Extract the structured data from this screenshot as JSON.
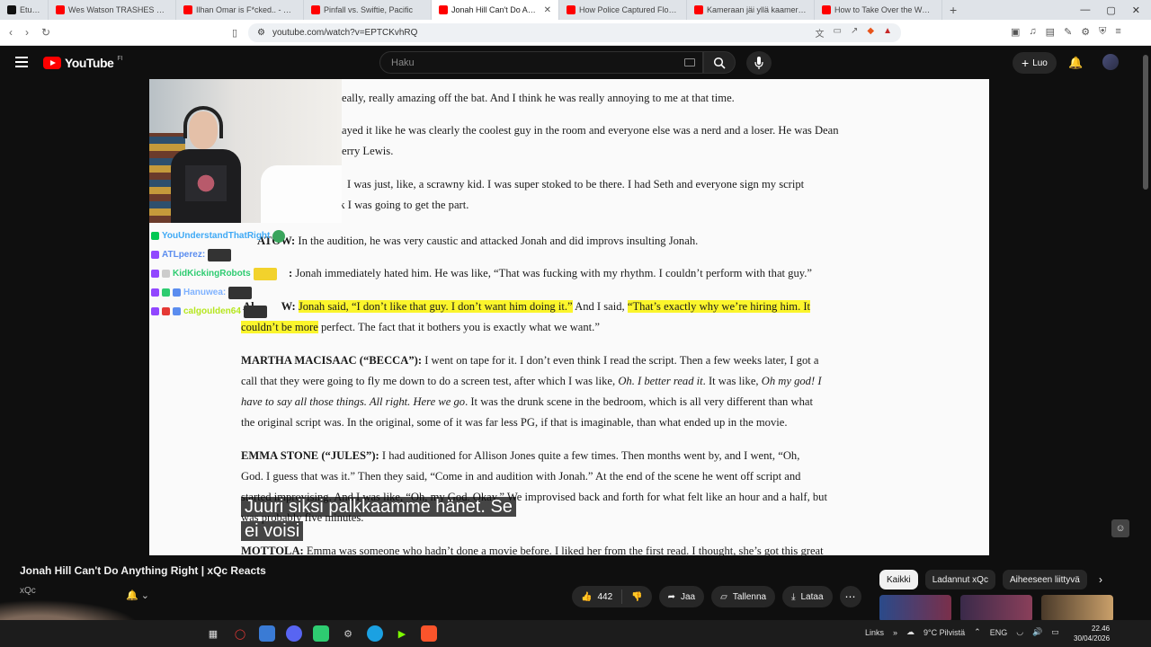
{
  "browser": {
    "tabs": [
      {
        "label": "Etusivu / X",
        "color": "#111111"
      },
      {
        "label": "Wes Watson TRASHES VICTIM",
        "color": "#ff0000"
      },
      {
        "label": "Ilhan Omar is F*cked.. - YouTu",
        "color": "#ff0000"
      },
      {
        "label": "Pinfall vs. Swiftie, Pacific",
        "color": "#ff0000"
      },
      {
        "label": "Jonah Hill Can't Do Anything",
        "color": "#ff0000"
      },
      {
        "label": "How Police Captured Florida's",
        "color": "#ff0000"
      },
      {
        "label": "Kameraan jäi yllä kaamerassa",
        "color": "#ff0000"
      },
      {
        "label": "How to Take Over the World -",
        "color": "#ff0000"
      }
    ],
    "close_glyph": "✕",
    "url": "youtube.com/watch?v=EPTCKvhRQ"
  },
  "header": {
    "logo": "YouTube",
    "region": "FI",
    "search_placeholder": "Haku",
    "create_label": "Luo"
  },
  "video": {
    "doc_lines": {
      "l1": "eally, really amazing off the bat. And I think he was really annoying to me at that time.",
      "l2a": "ayed it like he was clearly the coolest guy in the room and everyone else was a nerd and a loser. He was Dean",
      "l2b": "erry Lewis.",
      "l3a": "I was just, like, a scrawny kid. I was super stoked to be there. I had Seth and everyone sign my script",
      "l3b": "nk I was going to get the part.",
      "l4_speaker": "ATOW:",
      "l4": "In the audition, he was very caustic and attacked Jonah and did improvs insulting Jonah.",
      "l5_speaker": ":",
      "l5": "Jonah immediately hated him. He was like, “That was fucking with my rhythm. I couldn’t perform with that guy.”",
      "l6_speaker_a": "Al",
      "l6_speaker_b": "W:",
      "l6_hl1": "Jonah said, “I don’t like that guy. I don’t want him doing it.”",
      "l6_mid": "And I said,",
      "l6_hl2": "“That’s exactly why we’re hiring him. It",
      "l6b_hl": "couldn’t be more",
      "l6b_rest": "perfect. The fact that it bothers you is exactly what we want.”",
      "martha_speaker": "MARTHA MACISAAC (“BECCA”):",
      "martha_1": "I went on tape for it. I don’t even think I read the script. Then a few weeks later, I got a",
      "martha_2a": "call that they were going to fly me down to do a screen test, after which I was like,",
      "martha_2i": "Oh. I better read it",
      "martha_2b": ". It was like,",
      "martha_2j": "Oh my god! I",
      "martha_3i": "have to say all those things. All right. Here we go",
      "martha_3b": ". It was the drunk scene in the bedroom, which is all very different than what",
      "martha_4": "the original script was. In the original, some of it was far less PG, if that is imaginable, than what ended up in the movie.",
      "emma_speaker": "EMMA STONE (“JULES”):",
      "emma_1": "I had auditioned for Allison Jones quite a few times. Then months went by, and I went, “Oh,",
      "emma_2": "God. I guess that was it.” Then they said, “Come in and audition with Jonah.” At the end of the scene he went off script and",
      "emma_3": "started improvising. And I was like, “Oh, my God. Okay.” We improvised back and forth for what felt like an hour and a half, but",
      "emma_4": "was probably five minutes.",
      "mottola_speaker": "MOTTOLA:",
      "mottola_1": "Emma was someone who hadn’t done a movie before. I liked her from the first read. I thought, she’s got this great"
    },
    "chat": [
      {
        "user": "YouUnderstandThatRight",
        "color": "#3fa9f5",
        "badge": "green",
        "emote": "green"
      },
      {
        "user": "ATLperez:",
        "color": "#5b8def",
        "badge": "purple",
        "emote": "dark"
      },
      {
        "user": "KidKickingRobots",
        "color": "#2ecc71",
        "badge": "purple",
        "emote": "yellow"
      },
      {
        "user": "Hanuwea:",
        "color": "#7fb2ff",
        "badge": "purple",
        "emote": "dark"
      },
      {
        "user": "calgoulden64",
        "color": "#b5e61d",
        "badge": "red",
        "emote": "dark"
      }
    ],
    "subtitle_line1": "Juuri siksi palkkaamme hänet. Se",
    "subtitle_line2": "ei voisi"
  },
  "below": {
    "title": "Jonah Hill Can't Do Anything Right | xQc Reacts",
    "channel": "xQc",
    "like_count": "442",
    "share_label": "Jaa",
    "save_label": "Tallenna",
    "download_label": "Lataa",
    "more_glyph": "⋯",
    "chips": [
      "Kaikki",
      "Ladannut xQc",
      "Aiheeseen liittyvä"
    ]
  },
  "taskbar": {
    "links_label": "Links",
    "weather": "9°C Pilvistä",
    "lang": "ENG",
    "time": "22.46",
    "date": "30/04/2026"
  }
}
